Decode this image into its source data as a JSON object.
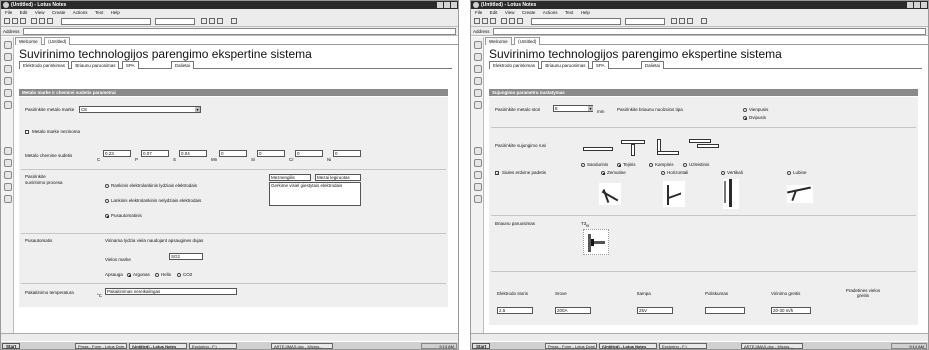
{
  "left": {
    "window_title": "(Untitled) - Lotus Notes",
    "menu": [
      "File",
      "Edit",
      "View",
      "Create",
      "Actions",
      "Text",
      "Help"
    ],
    "address_label": "Address",
    "doc_tabs": [
      "Welcome",
      "(Untitled)"
    ],
    "form_title": "Suvirinimo technologijos parengimo ekspertine sistema",
    "form_tabs": [
      "Elektrodo parinkimas",
      "Briaunu paruosimas",
      "SPA",
      "Dalietai"
    ],
    "section_header": "Metalo marke ir cheminė sudetis parametrai",
    "metal_mark_label": "Pasirinkite metalo marke",
    "metal_mark_value": "C8",
    "metal_unknown_label": "Metalo marke nezinoma",
    "chem_label": "Metalo chemine sudetis",
    "chem": [
      {
        "el": "C",
        "val": "0.23"
      },
      {
        "el": "P",
        "val": "0.07"
      },
      {
        "el": "S",
        "val": "0.04"
      },
      {
        "el": "Mn",
        "val": "0"
      },
      {
        "el": "Si",
        "val": "0"
      },
      {
        "el": "Cr",
        "val": "0"
      },
      {
        "el": "Ni",
        "val": "0"
      }
    ],
    "process_label": "Pasirinkite suvirinimo procesa",
    "process_options": [
      "Rankinis elektrolankinis lydziais elektrodais",
      "Lankinis elektrolankinis nelydziais elektrodais",
      "Pusautomatinis"
    ],
    "electrode_field_1": "Meznengilis",
    "electrode_field_2": "Mezai legiruotas",
    "electrode_desc": "Gerkime visiel giestytais elektrodais",
    "semi_auto_label": "Pusautomatis",
    "gas_question": "Virinama lydzia viela naudojant apsaugines dujas",
    "wire_label": "Vielos marke",
    "wire_value": "SG2",
    "shield_label": "Apsauga",
    "shield_options": [
      "Argonas",
      "Helis",
      "CO2"
    ],
    "preheat_label": "Pakaitinimo temperatura",
    "preheat_unit": "°C",
    "preheat_value": "Pakaitinimas nereikalingas",
    "taskbar": {
      "start": "Start",
      "items": [
        "Prnas - Form - Lotus Dom...",
        "(Untitled) - Lotus Notes",
        "Exploring - F:\\",
        "ARTEJIMAS.doc - Micros..."
      ],
      "clock": "9:13 AM"
    }
  },
  "right": {
    "window_title": "(Untitled) - Lotus Notes",
    "menu": [
      "File",
      "Edit",
      "View",
      "Create",
      "Actions",
      "Text",
      "Help"
    ],
    "address_label": "Address",
    "doc_tabs": [
      "Welcome",
      "(Untitled)"
    ],
    "form_title": "Suvirinimo technologijos parengimo ekspertine sistema",
    "form_tabs": [
      "Elektrodo parinkimas",
      "Briaunu paruosimas",
      "SPA",
      "Dalietai"
    ],
    "section_header": "Sujungimo parametru nustatymas",
    "metal_thickness_label": "Pasirinkite metalo stori",
    "metal_thickness_value": "8",
    "metal_thickness_unit": "mm",
    "edge_type_label": "Pasirinkite briaunu nuolzulos tipa",
    "edge_type_options": [
      "Vienpusis",
      "Dvipusis"
    ],
    "joint_type_label": "Pasirinkite sujungimo rusi",
    "joint_options": [
      "Sandurinis",
      "Tejinis",
      "Kampinis",
      "Uzleistinis"
    ],
    "seam_pos_label": "Siules erdvine padetis",
    "seam_pos_options": [
      "Zemutine",
      "Horizontali",
      "Vertikali",
      "Lubine"
    ],
    "edge_prep_label": "Briaunu paruosimas",
    "edge_prep_code": "T3",
    "edge_prep_sub": "t5",
    "params": [
      {
        "label": "Elektrodo storis",
        "value": "2.5"
      },
      {
        "label": "Srove",
        "value": "200A"
      },
      {
        "label": "Itampa",
        "value": "25V"
      },
      {
        "label": "Poliskumas",
        "value": ""
      },
      {
        "label": "Virinimo greitis",
        "value": "20-30 m/h"
      },
      {
        "label": "Pradetines vielos greitis",
        "value": ""
      }
    ],
    "taskbar": {
      "start": "Start",
      "items": [
        "Prnas - Form - Lotus Domi...",
        "(Untitled) - Lotus Notes",
        "Exploring - F:\\",
        "ARTEJIMAS.doc - Micros..."
      ],
      "clock": "9:14 AM"
    }
  }
}
